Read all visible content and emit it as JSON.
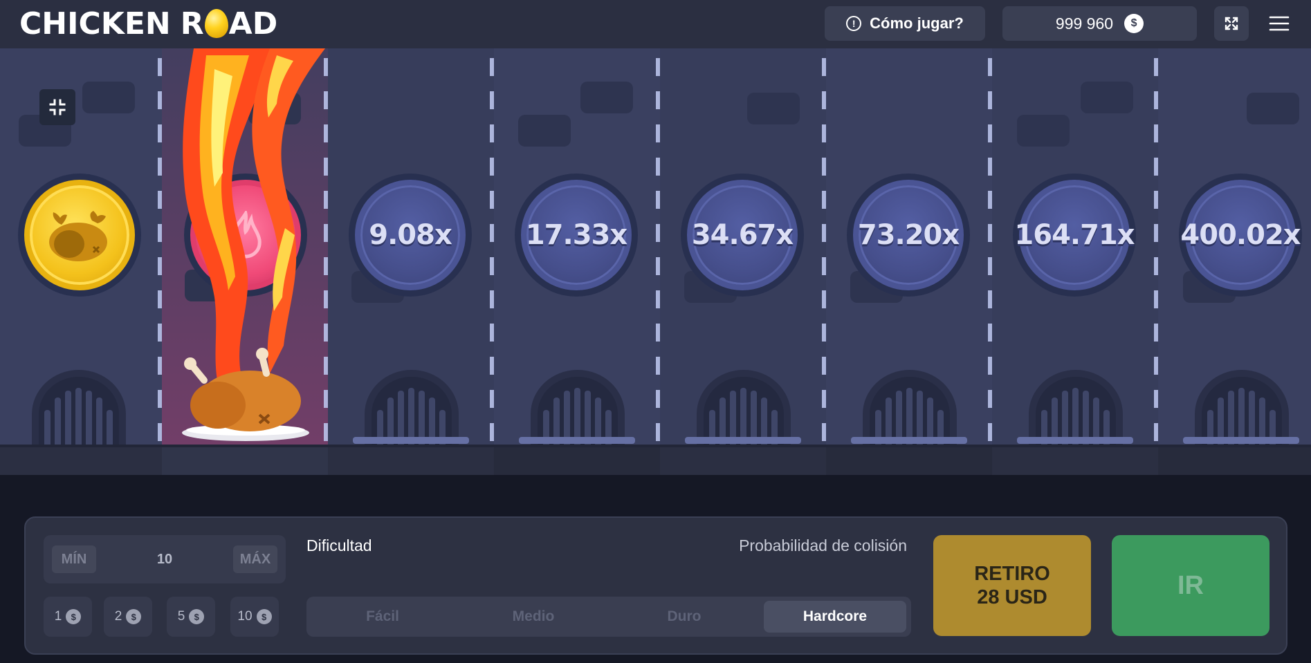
{
  "header": {
    "logo_word1": "CHICKEN",
    "logo_word2_pre": "R",
    "logo_word2_post": "AD",
    "help_label": "Cómo jugar?",
    "balance": "999 960",
    "currency_symbol": "$"
  },
  "game": {
    "multipliers": [
      "9.08x",
      "17.33x",
      "34.67x",
      "73.20x",
      "164.71x",
      "400.02x"
    ],
    "passed_lane": "gold-coin",
    "crashed_lane": "fire-coin"
  },
  "controls": {
    "min_label": "MÍN",
    "max_label": "MÁX",
    "bet_value": "10",
    "chips": [
      "1",
      "2",
      "5",
      "10"
    ],
    "chip_symbol": "$",
    "difficulty_label": "Dificultad",
    "collision_label": "Probabilidad de colisión",
    "difficulties": [
      "Fácil",
      "Medio",
      "Duro",
      "Hardcore"
    ],
    "active_difficulty": "Hardcore",
    "cashout_line1": "RETIRO",
    "cashout_line2": "28 USD",
    "go_label": "IR"
  },
  "colors": {
    "gold": "#f4c21c",
    "fire": "#f04a78",
    "cashout": "#ae8b2f",
    "go": "#3c9a5e"
  }
}
